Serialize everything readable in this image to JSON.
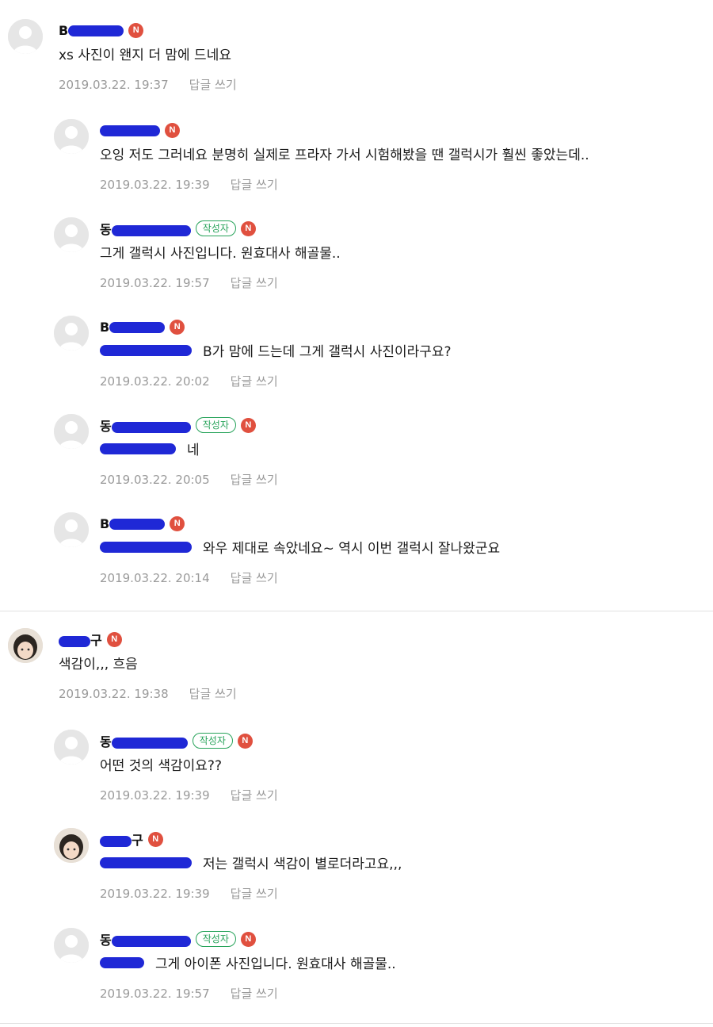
{
  "comments": [
    {
      "nick": "B",
      "nick_redacted": true,
      "text": "xs 사진이 왠지 더 맘에 드네요",
      "date": "2019.03.22. 19:37",
      "reply": "답글 쓰기"
    },
    {
      "nick": "",
      "nick_redacted": true,
      "text": "오잉 저도 그러네요 분명히 실제로 프라자 가서 시험해봤을 땐 갤럭시가 훨씬 좋았는데..",
      "date": "2019.03.22. 19:39",
      "reply": "답글 쓰기"
    },
    {
      "nick": "동",
      "nick_redacted": true,
      "author": "작성자",
      "text": "그게 갤럭시 사진입니다. 원효대사 해골물..",
      "date": "2019.03.22. 19:57",
      "reply": "답글 쓰기"
    },
    {
      "nick": "B",
      "nick_redacted": true,
      "text": "B가 맘에 드는데 그게 갤럭시 사진이라구요?",
      "date": "2019.03.22. 20:02",
      "reply": "답글 쓰기"
    },
    {
      "nick": "동",
      "nick_redacted": true,
      "author": "작성자",
      "text": "네",
      "date": "2019.03.22. 20:05",
      "reply": "답글 쓰기"
    },
    {
      "nick": "B",
      "nick_redacted": true,
      "text": "와우 제대로 속았네요~ 역시 이번 갤럭시 잘나왔군요",
      "date": "2019.03.22. 20:14",
      "reply": "답글 쓰기"
    },
    {
      "nick": "구",
      "nick_redacted": true,
      "text": "색감이,,, 흐음",
      "date": "2019.03.22. 19:38",
      "reply": "답글 쓰기"
    },
    {
      "nick": "동",
      "nick_redacted": true,
      "author": "작성자",
      "text": "어떤 것의 색감이요??",
      "date": "2019.03.22. 19:39",
      "reply": "답글 쓰기"
    },
    {
      "nick": "구",
      "nick_redacted": true,
      "text": "저는 갤럭시 색감이 별로더라고요,,,",
      "date": "2019.03.22. 19:39",
      "reply": "답글 쓰기"
    },
    {
      "nick": "동",
      "nick_redacted": true,
      "author": "작성자",
      "text": "그게 아이폰 사진입니다. 원효대사 해골물..",
      "date": "2019.03.22. 19:57",
      "reply": "답글 쓰기"
    }
  ],
  "badges": {
    "new": "N"
  },
  "colors": {
    "new_badge": "#e0503f",
    "author_badge": "#27a35a",
    "redaction": "#1f28d6",
    "meta": "#9a9a9a"
  },
  "icons": {
    "default_avatar": "person-silhouette-icon",
    "photo_avatar": "profile-photo-icon"
  }
}
